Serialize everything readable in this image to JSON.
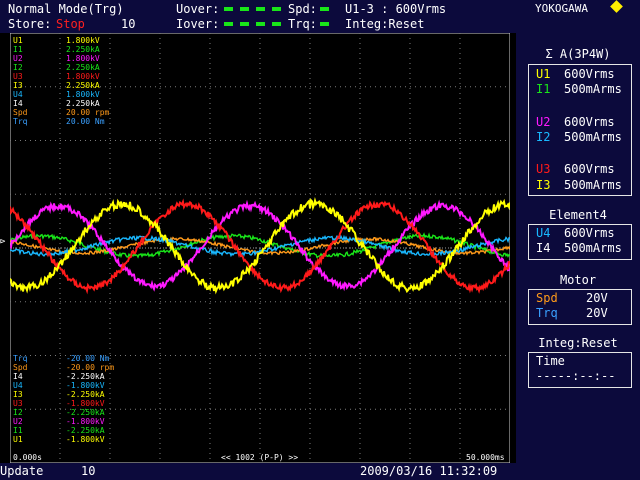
{
  "header": {
    "mode": "Normal Mode(Trg)",
    "store_label": "Store:",
    "store_state": "Stop",
    "store_count": "10",
    "uover_label": "Uover:",
    "iover_label": "Iover:",
    "spd_label": "Spd:",
    "trq_label": "Trq:",
    "range_text": "U1-3 : 600Vrms",
    "integ_text": "Integ:Reset",
    "brand": "YOKOGAWA"
  },
  "colors": {
    "U1": "#ffff00",
    "I1": "#19e619",
    "U2": "#ff19ff",
    "I2": "#19e619",
    "U3": "#ff1a1a",
    "I3": "#ffff00",
    "U4": "#19b8ff",
    "I4": "#ffffff",
    "Spd": "#ff9a1a",
    "Trq": "#3aa0ff",
    "accent": "#ffee00"
  },
  "upper_labels": [
    {
      "ch": "U1",
      "val": "1.800kV",
      "color": "#ffff00"
    },
    {
      "ch": "I1",
      "val": "2.250kA",
      "color": "#19e619"
    },
    {
      "ch": "U2",
      "val": "1.800kV",
      "color": "#ff19ff"
    },
    {
      "ch": "I2",
      "val": "2.250kA",
      "color": "#19e619"
    },
    {
      "ch": "U3",
      "val": "1.800kV",
      "color": "#ff1a1a"
    },
    {
      "ch": "I3",
      "val": "2.250kA",
      "color": "#ffff00"
    },
    {
      "ch": "U4",
      "val": "1.800kV",
      "color": "#19b8ff"
    },
    {
      "ch": "I4",
      "val": "2.250kA",
      "color": "#ffffff"
    },
    {
      "ch": "Spd",
      "val": "20.00 rpm",
      "color": "#ff9a1a"
    },
    {
      "ch": "Trq",
      "val": "20.00 Nm",
      "color": "#3aa0ff"
    }
  ],
  "lower_labels": [
    {
      "ch": "Trq",
      "val": "-20.00 Nm",
      "color": "#3aa0ff"
    },
    {
      "ch": "Spd",
      "val": "-20.00 rpm",
      "color": "#ff9a1a"
    },
    {
      "ch": "I4",
      "val": "-2.250kA",
      "color": "#ffffff"
    },
    {
      "ch": "U4",
      "val": "-1.800kV",
      "color": "#19b8ff"
    },
    {
      "ch": "I3",
      "val": "-2.250kA",
      "color": "#ffff00"
    },
    {
      "ch": "U3",
      "val": "-1.800kV",
      "color": "#ff1a1a"
    },
    {
      "ch": "I2",
      "val": "-2.250kA",
      "color": "#19e619"
    },
    {
      "ch": "U2",
      "val": "-1.800kV",
      "color": "#ff19ff"
    },
    {
      "ch": "I1",
      "val": "-2.250kA",
      "color": "#19e619"
    },
    {
      "ch": "U1",
      "val": "-1.800kV",
      "color": "#ffff00"
    }
  ],
  "plot_footer": {
    "start_time": "0.000s",
    "points": "<< 1002 (P-P) >>",
    "end_time": "50.000ms"
  },
  "sidebar": {
    "group1_title": "Σ A(3P4W)",
    "group1_rows": [
      {
        "ch": "U1",
        "val": "600Vrms",
        "color": "#ffff00"
      },
      {
        "ch": "I1",
        "val": "500mArms",
        "color": "#19e619"
      },
      {
        "ch": "U2",
        "val": "600Vrms",
        "color": "#ff19ff"
      },
      {
        "ch": "I2",
        "val": "500mArms",
        "color": "#19b8ff"
      },
      {
        "ch": "U3",
        "val": "600Vrms",
        "color": "#ff1a1a"
      },
      {
        "ch": "I3",
        "val": "500mArms",
        "color": "#ffff00"
      }
    ],
    "group2_title": "Element4",
    "group2_rows": [
      {
        "ch": "U4",
        "val": "600Vrms",
        "color": "#19b8ff"
      },
      {
        "ch": "I4",
        "val": "500mArms",
        "color": "#ffffff"
      }
    ],
    "group3_title": "Motor",
    "group3_rows": [
      {
        "ch": "Spd",
        "val": "20V",
        "color": "#ff9a1a"
      },
      {
        "ch": "Trq",
        "val": "20V",
        "color": "#3aa0ff"
      }
    ],
    "group4_title": "Integ:Reset",
    "time_label": "Time",
    "time_value": "-----:--:--"
  },
  "footer": {
    "update_label": "Update",
    "update_count": "10",
    "datetime": "2009/03/16 11:32:09"
  }
}
